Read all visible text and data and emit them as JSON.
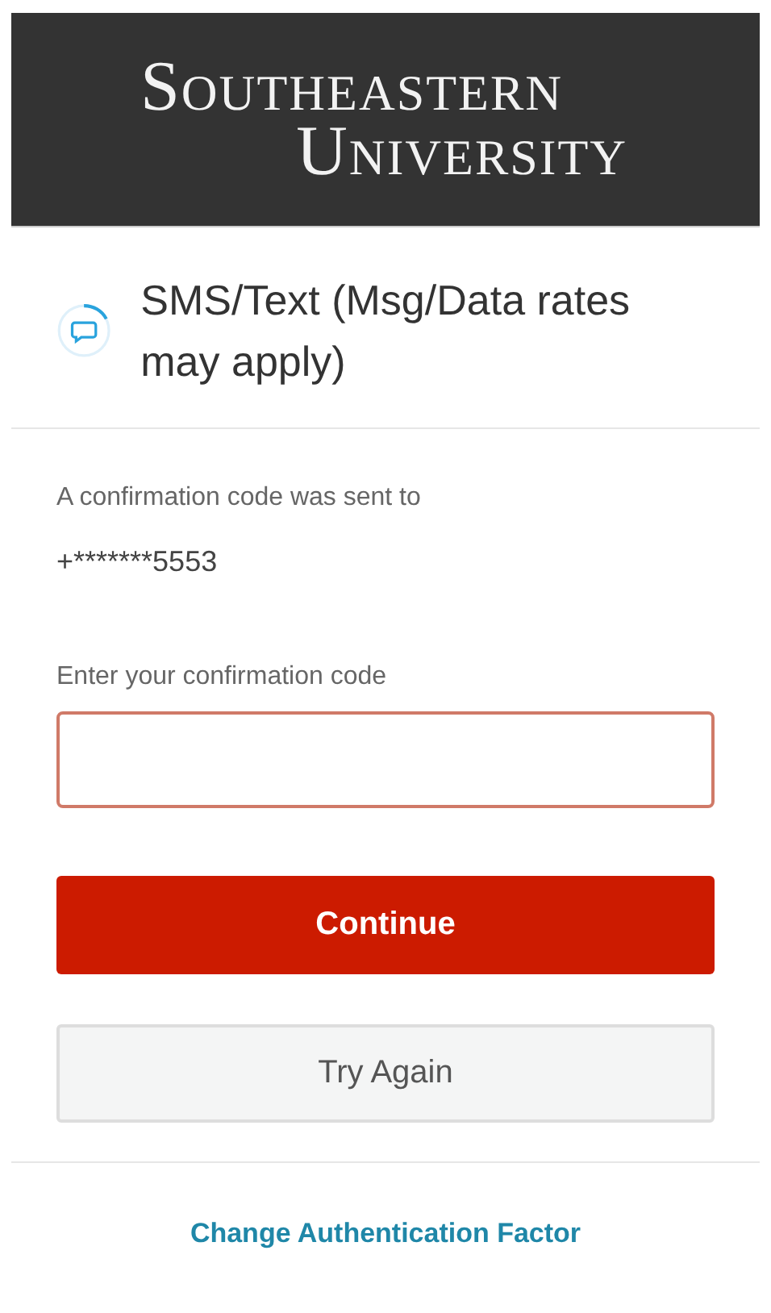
{
  "header": {
    "logo_line_1": "Southeastern",
    "logo_line_2": "University"
  },
  "method": {
    "title": "SMS/Text (Msg/Data rates may apply)"
  },
  "message": "A confirmation code was sent to",
  "phone": "+*******5553",
  "code_field": {
    "label": "Enter your confirmation code"
  },
  "buttons": [
    {
      "kind": "primary",
      "label": "Continue"
    },
    {
      "kind": "secondary",
      "label": "Try Again"
    }
  ],
  "link": "Change Authentication Factor"
}
